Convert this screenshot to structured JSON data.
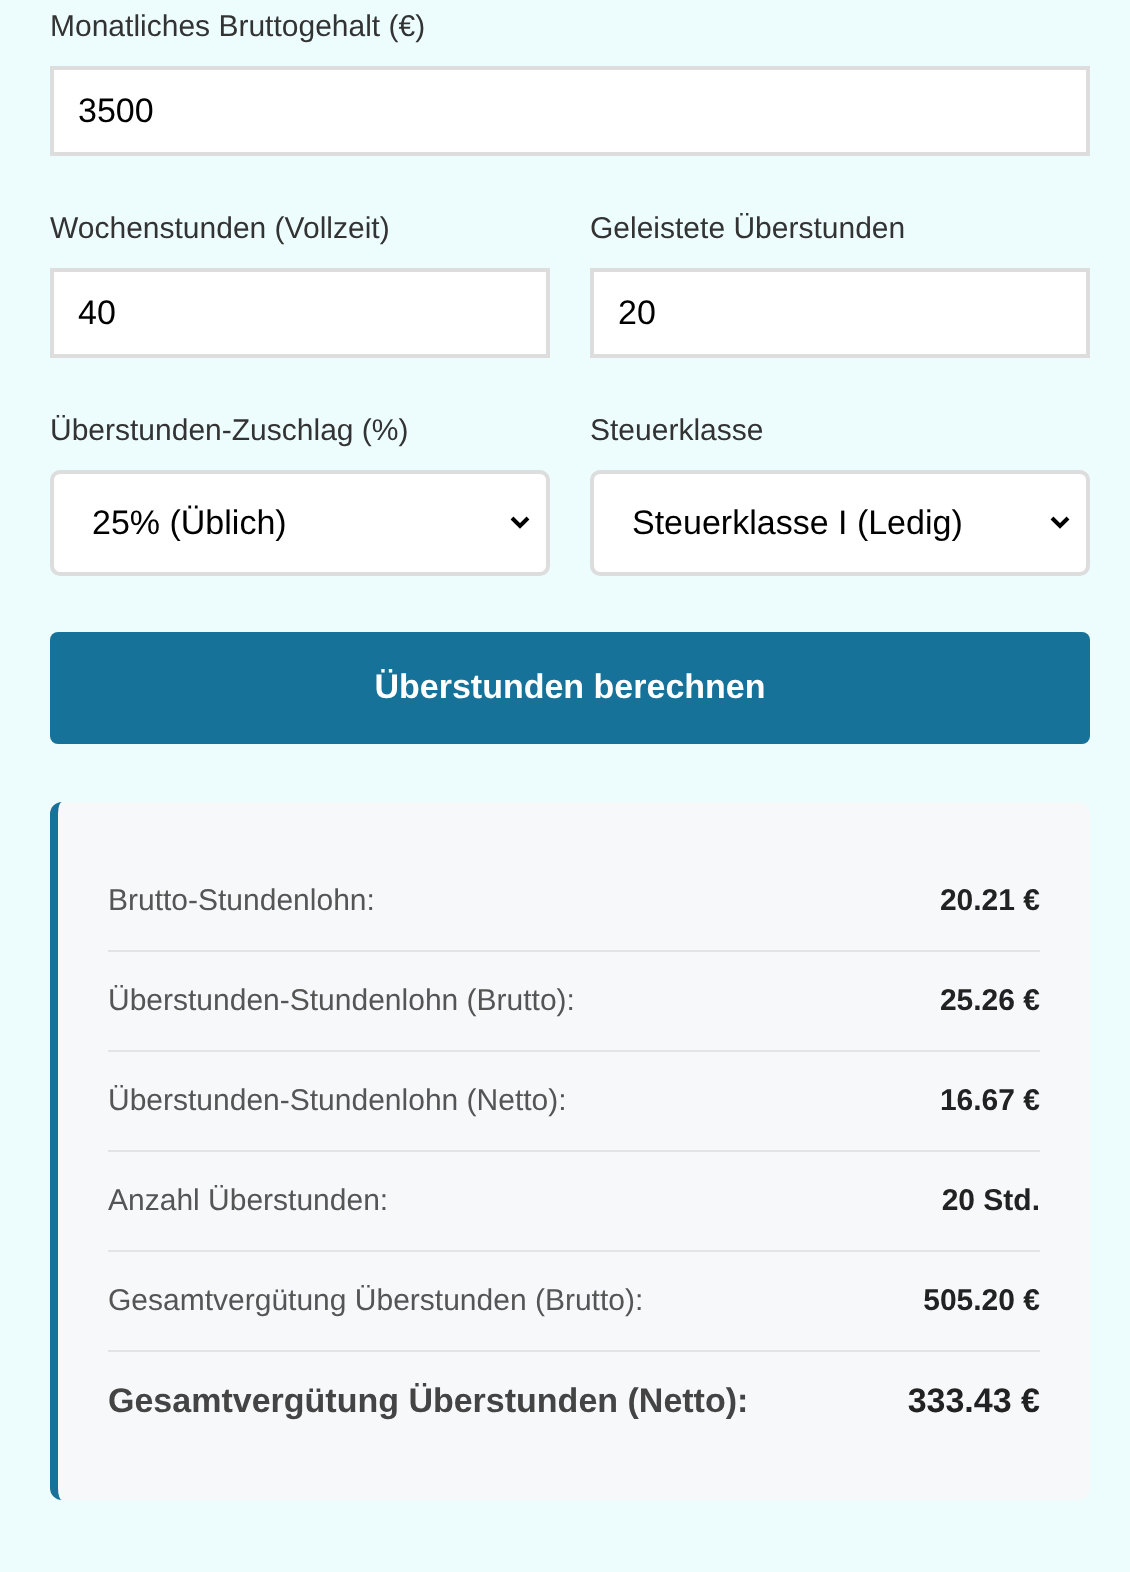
{
  "form": {
    "rows": [
      {
        "fields": [
          {
            "kind": "text",
            "label": "Monatliches Bruttogehalt (€)",
            "value": "3500"
          }
        ]
      },
      {
        "fields": [
          {
            "kind": "text",
            "label": "Wochenstunden (Vollzeit)",
            "value": "40"
          },
          {
            "kind": "text",
            "label": "Geleistete Überstunden",
            "value": "20"
          }
        ]
      },
      {
        "fields": [
          {
            "kind": "select",
            "label": "Überstunden-Zuschlag (%)",
            "value": "25% (Üblich)"
          },
          {
            "kind": "select",
            "label": "Steuerklasse",
            "value": "Steuerklasse I (Ledig)"
          }
        ]
      }
    ]
  },
  "submit_button": "Überstunden berechnen",
  "results": [
    {
      "kind": "normal",
      "label": "Brutto-Stundenlohn:",
      "value": "20.21 €"
    },
    {
      "kind": "normal",
      "label": "Überstunden-Stundenlohn (Brutto):",
      "value": "25.26 €"
    },
    {
      "kind": "normal",
      "label": "Überstunden-Stundenlohn (Netto):",
      "value": "16.67 €"
    },
    {
      "kind": "normal",
      "label": "Anzahl Überstunden:",
      "value": "20 Std."
    },
    {
      "kind": "normal",
      "label": "Gesamtvergütung Überstunden (Brutto):",
      "value": "505.20 €"
    },
    {
      "kind": "total",
      "label": "Gesamtvergütung Überstunden (Netto):",
      "value": "333.43 €"
    }
  ]
}
